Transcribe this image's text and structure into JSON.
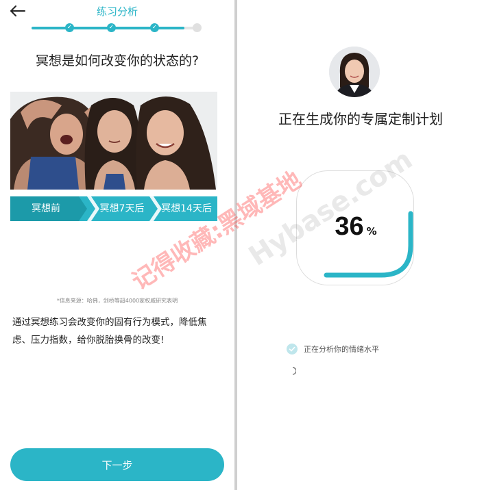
{
  "left_screen": {
    "header_title": "练习分析",
    "progress": {
      "completed_steps": 3,
      "total_steps": 4,
      "fraction": 0.93
    },
    "question": "冥想是如何改变你的状态的?",
    "stages": [
      "冥想前",
      "冥想7天后",
      "冥想14天后"
    ],
    "source_note": "*信息来源：哈佛，剑桥等超4000家权威研究表明",
    "description": "通过冥想练习会改变你的固有行为模式，降低焦虑、压力指数，给你脱胎换骨的改变!",
    "next_button": "下一步"
  },
  "right_screen": {
    "title": "正在生成你的专属定制计划",
    "progress_value": "36",
    "progress_unit": "%",
    "progress_fraction": 0.36,
    "task_label": "正在分析你的情绪水平"
  },
  "watermark": {
    "text_cn": "记得收藏:黑域基地",
    "text_en": "Hybase.com"
  },
  "colors": {
    "accent": "#2bb5c7",
    "accent_dark": "#1c9aa9",
    "divider": "#cfcfcf"
  }
}
